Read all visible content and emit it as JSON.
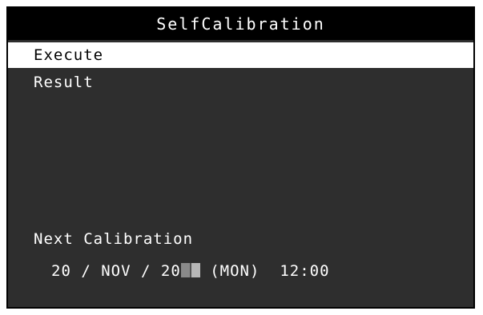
{
  "window": {
    "title": "SelfCalibration"
  },
  "menu": {
    "items": [
      {
        "label": "Execute",
        "selected": true
      },
      {
        "label": "Result",
        "selected": false
      }
    ]
  },
  "next_calibration": {
    "label": "Next Calibration",
    "day": "20",
    "month": "NOV",
    "year_prefix": "20",
    "weekday": "(MON)",
    "time": "12:00"
  },
  "colors": {
    "background": "#2e2e2e",
    "title_bar": "#000000",
    "selected_bg": "#ffffff",
    "text": "#ffffff"
  }
}
